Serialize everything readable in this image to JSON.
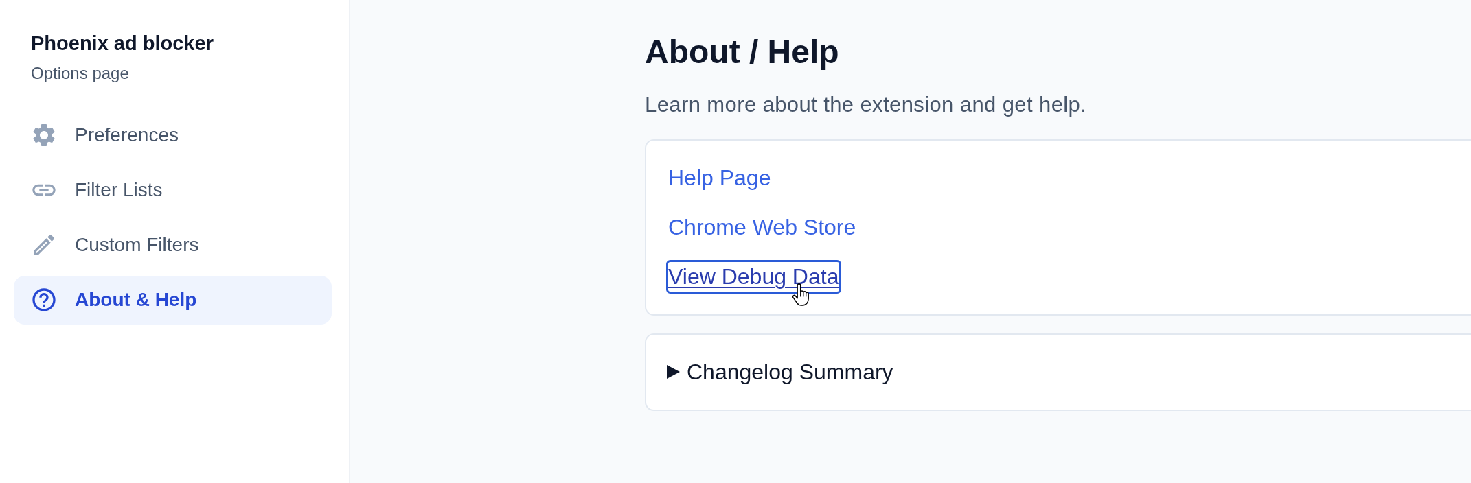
{
  "sidebar": {
    "title": "Phoenix ad blocker",
    "subtitle": "Options page",
    "items": [
      {
        "label": "Preferences",
        "selected": false
      },
      {
        "label": "Filter Lists",
        "selected": false
      },
      {
        "label": "Custom Filters",
        "selected": false
      },
      {
        "label": "About & Help",
        "selected": true
      }
    ]
  },
  "main": {
    "title": "About / Help",
    "description": "Learn more about the extension and get help.",
    "links": [
      {
        "label": "Help Page",
        "focused": false,
        "hovered": false
      },
      {
        "label": "Chrome Web Store",
        "focused": false,
        "hovered": false
      },
      {
        "label": "View Debug Data",
        "focused": true,
        "hovered": true
      }
    ],
    "changelog": {
      "label": "Changelog Summary",
      "expanded": false
    }
  }
}
